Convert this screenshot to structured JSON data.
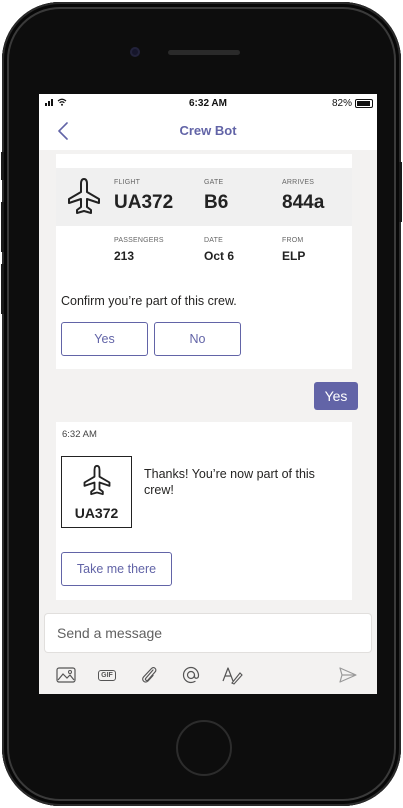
{
  "status": {
    "time": "6:32 AM",
    "battery": "82%"
  },
  "nav": {
    "title": "Crew Bot",
    "back_icon": "chevron-left-icon"
  },
  "flight_card": {
    "flight_label": "FLIGHT",
    "flight_value": "UA372",
    "gate_label": "GATE",
    "gate_value": "B6",
    "arrives_label": "ARRIVES",
    "arrives_value": "844a",
    "passengers_label": "PASSENGERS",
    "passengers_value": "213",
    "date_label": "DATE",
    "date_value": "Oct 6",
    "from_label": "FROM",
    "from_value": "ELP",
    "prompt": "Confirm you’re part of this crew.",
    "yes_label": "Yes",
    "no_label": "No"
  },
  "user_reply": "Yes",
  "bot_reply": {
    "timestamp": "6:32 AM",
    "thumbnail_label": "UA372",
    "message": "Thanks! You’re now part of this crew!",
    "action_label": "Take me there"
  },
  "composer": {
    "placeholder": "Send a message"
  },
  "toolbar": {
    "icons": [
      "image-icon",
      "gif-icon",
      "attach-icon",
      "mention-icon",
      "format-icon",
      "send-icon"
    ],
    "gif_text": "GIF"
  },
  "colors": {
    "accent": "#6264a7",
    "background": "#f3f2f1"
  }
}
